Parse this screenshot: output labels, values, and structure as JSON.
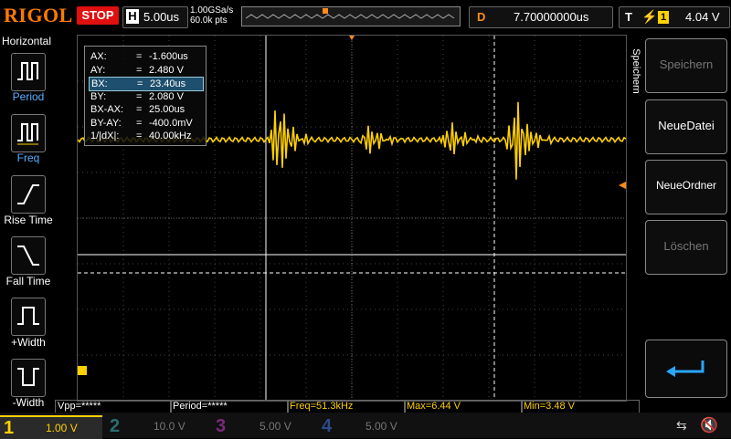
{
  "top": {
    "logo": "RIGOL",
    "run_state": "STOP",
    "timebase_label": "H",
    "timebase_value": "5.00us",
    "sample_rate": "1.00GSa/s",
    "memory_depth": "60.0k pts",
    "delay_label": "D",
    "delay_value": "7.70000000us",
    "trigger_label": "T",
    "trigger_channel": "1",
    "trigger_level": "4.04 V"
  },
  "left_panel": {
    "title": "Horizontal",
    "items": [
      {
        "label": "Period",
        "icon": "period-icon"
      },
      {
        "label": "Freq",
        "icon": "freq-icon"
      },
      {
        "label": "Rise Time",
        "icon": "rise-time-icon"
      },
      {
        "label": "Fall Time",
        "icon": "fall-time-icon"
      },
      {
        "label": "+Width",
        "icon": "positive-width-icon"
      },
      {
        "label": "-Width",
        "icon": "negative-width-icon"
      }
    ]
  },
  "cursor_readout": {
    "rows": [
      {
        "key": "AX:",
        "value": "-1.600us",
        "selected": false
      },
      {
        "key": "AY:",
        "value": "2.480 V",
        "selected": false
      },
      {
        "key": "BX:",
        "value": "23.40us",
        "selected": true
      },
      {
        "key": "BY:",
        "value": "2.080 V",
        "selected": false
      },
      {
        "key": "BX-AX:",
        "value": "25.00us",
        "selected": false
      },
      {
        "key": "BY-AY:",
        "value": "-400.0mV",
        "selected": false
      },
      {
        "key": "1/|dX|:",
        "value": "40.00kHz",
        "selected": false
      }
    ],
    "equals": "="
  },
  "right_panel": {
    "title": "Speichern",
    "buttons": [
      {
        "label": "Speichern",
        "enabled": false
      },
      {
        "label": "NeueDatei",
        "enabled": true
      },
      {
        "label": "NeueOrdner",
        "enabled": true
      },
      {
        "label": "Löschen",
        "enabled": false
      }
    ],
    "back_icon": "return-arrow-icon"
  },
  "measurements": {
    "vpp": "Vpp=*****",
    "period": "Period=*****",
    "freq": "Freq=51.3kHz",
    "max": "Max=6.44 V",
    "min": "Min=3.48 V"
  },
  "channels": [
    {
      "num": "1",
      "scale": "1.00 V",
      "color": "#ffd000",
      "active": true
    },
    {
      "num": "2",
      "scale": "10.0 V",
      "color": "#00d0d0",
      "active": false
    },
    {
      "num": "3",
      "scale": "5.00 V",
      "color": "#e040e0",
      "active": false
    },
    {
      "num": "4",
      "scale": "5.00 V",
      "color": "#3a7cff",
      "active": false
    }
  ],
  "colors": {
    "ch1": "#ffd000",
    "accent": "#ff8c1a",
    "stop": "#e01010"
  }
}
